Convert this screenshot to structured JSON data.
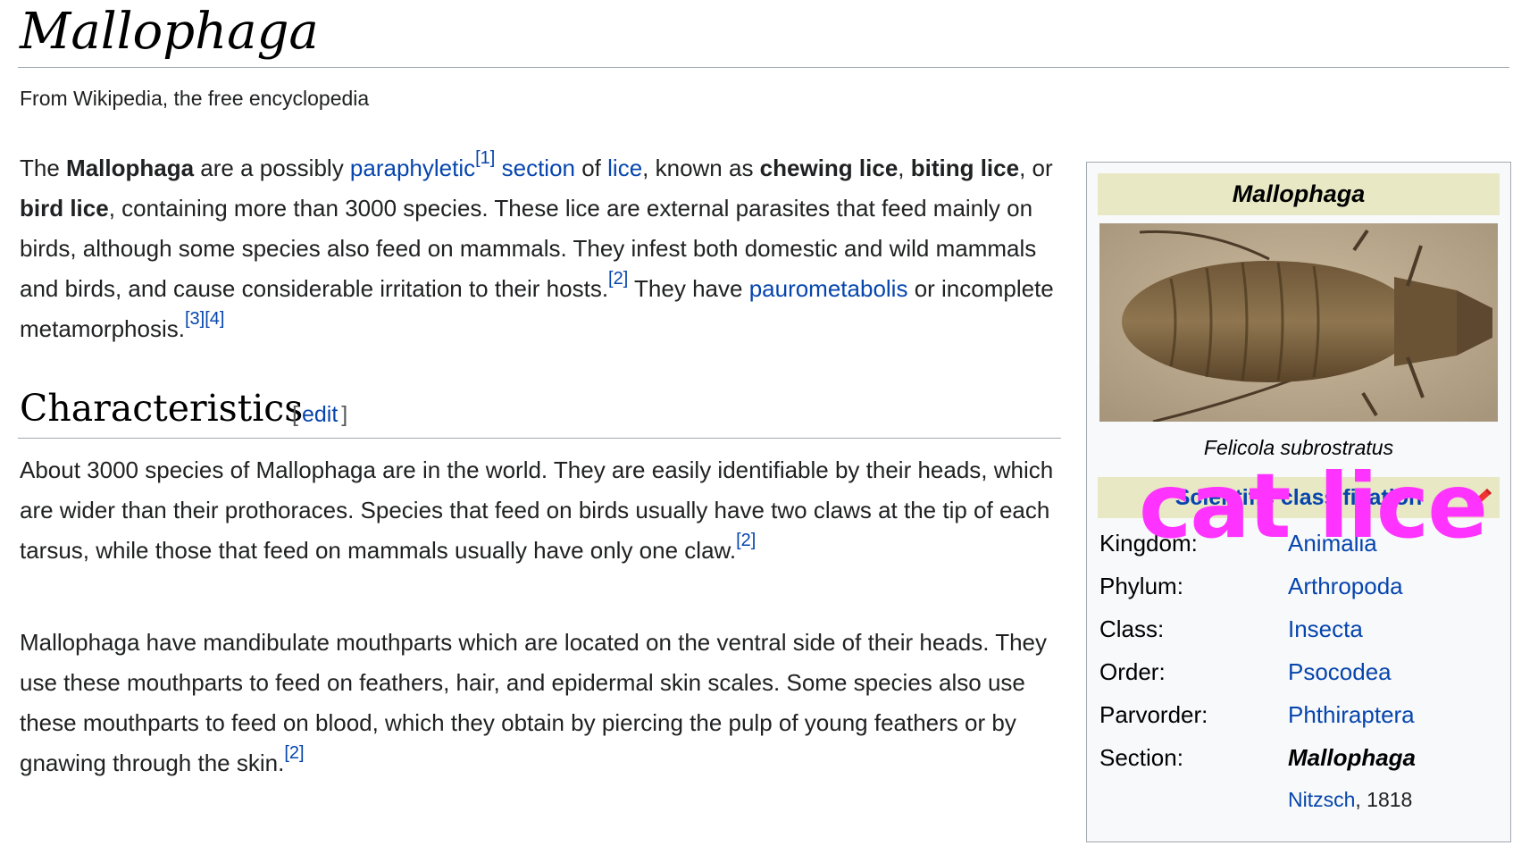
{
  "article": {
    "title": "Mallophaga",
    "tagline": "From Wikipedia, the free encyclopedia"
  },
  "intro": {
    "s1": "The ",
    "b1": "Mallophaga",
    "s2": " are a possibly ",
    "l1": "paraphyletic",
    "r1": "[1]",
    "s3": " ",
    "l2": "section",
    "s4": " of ",
    "l3": "lice",
    "s5": ", known as ",
    "b2": "chewing lice",
    "s6": ", ",
    "b3": "biting lice",
    "s7": ", or ",
    "b4": "bird lice",
    "s8": ", containing more than 3000 species. These lice are external parasites that feed mainly on birds, although some species also feed on mammals. They infest both domestic and wild mammals and birds, and cause considerable irritation to their hosts.",
    "r2": "[2]",
    "s9": " They have ",
    "l4": "paurometabolis",
    "s10": " or incomplete metamorphosis.",
    "r3": "[3]",
    "r4": "[4]"
  },
  "characteristics": {
    "heading": "Characteristics",
    "edit_open": "[",
    "edit_label": "edit",
    "edit_close": "]",
    "p1": "About 3000 species of Mallophaga are in the world. They are easily identifiable by their heads, which are wider than their prothoraces. Species that feed on birds usually have two claws at the tip of each tarsus, while those that feed on mammals usually have only one claw.",
    "p1_ref": "[2]",
    "p2": "Mallophaga have mandibulate mouthparts which are located on the ventral side of their heads. They use these mouthparts to feed on feathers, hair, and epidermal skin scales. Some species also use these mouthparts to feed on blood, which they obtain by piercing the pulp of young feathers or by gnawing through the skin.",
    "p2_ref": "[2]"
  },
  "infobox": {
    "title": "Mallophaga",
    "image_icon": "louse-photo",
    "caption": "Felicola subrostratus",
    "sci_header": "Scientific classification",
    "edit_icon": "pencil-icon",
    "rows": [
      {
        "rank": "Kingdom:",
        "taxon": "Animalia"
      },
      {
        "rank": "Phylum:",
        "taxon": "Arthropoda"
      },
      {
        "rank": "Class:",
        "taxon": "Insecta"
      },
      {
        "rank": "Order:",
        "taxon": "Psocodea"
      },
      {
        "rank": "Parvorder:",
        "taxon": "Phthiraptera"
      },
      {
        "rank": "Section:",
        "taxon": "Mallophaga"
      }
    ],
    "authority_link": "Nitzsch",
    "authority_year": ", 1818"
  },
  "overlay": {
    "text": "cat lice",
    "color": "#ff33ff"
  },
  "colors": {
    "link": "#0645ad",
    "infobox_header_bg": "#e8e8c4"
  }
}
